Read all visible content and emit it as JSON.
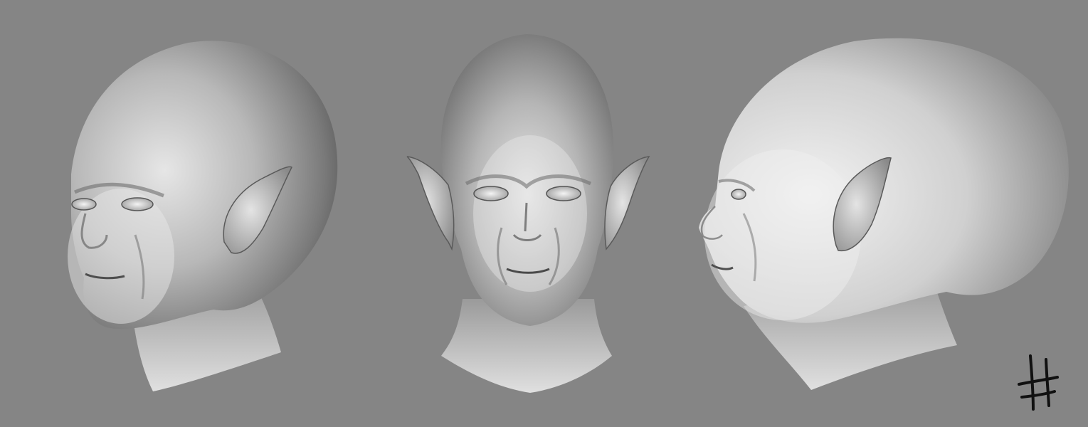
{
  "scene": {
    "background_color": "#858585",
    "views": [
      {
        "id": "three-quarter",
        "label": ""
      },
      {
        "id": "front",
        "label": ""
      },
      {
        "id": "profile",
        "label": ""
      }
    ],
    "signature": {
      "text": ""
    }
  }
}
